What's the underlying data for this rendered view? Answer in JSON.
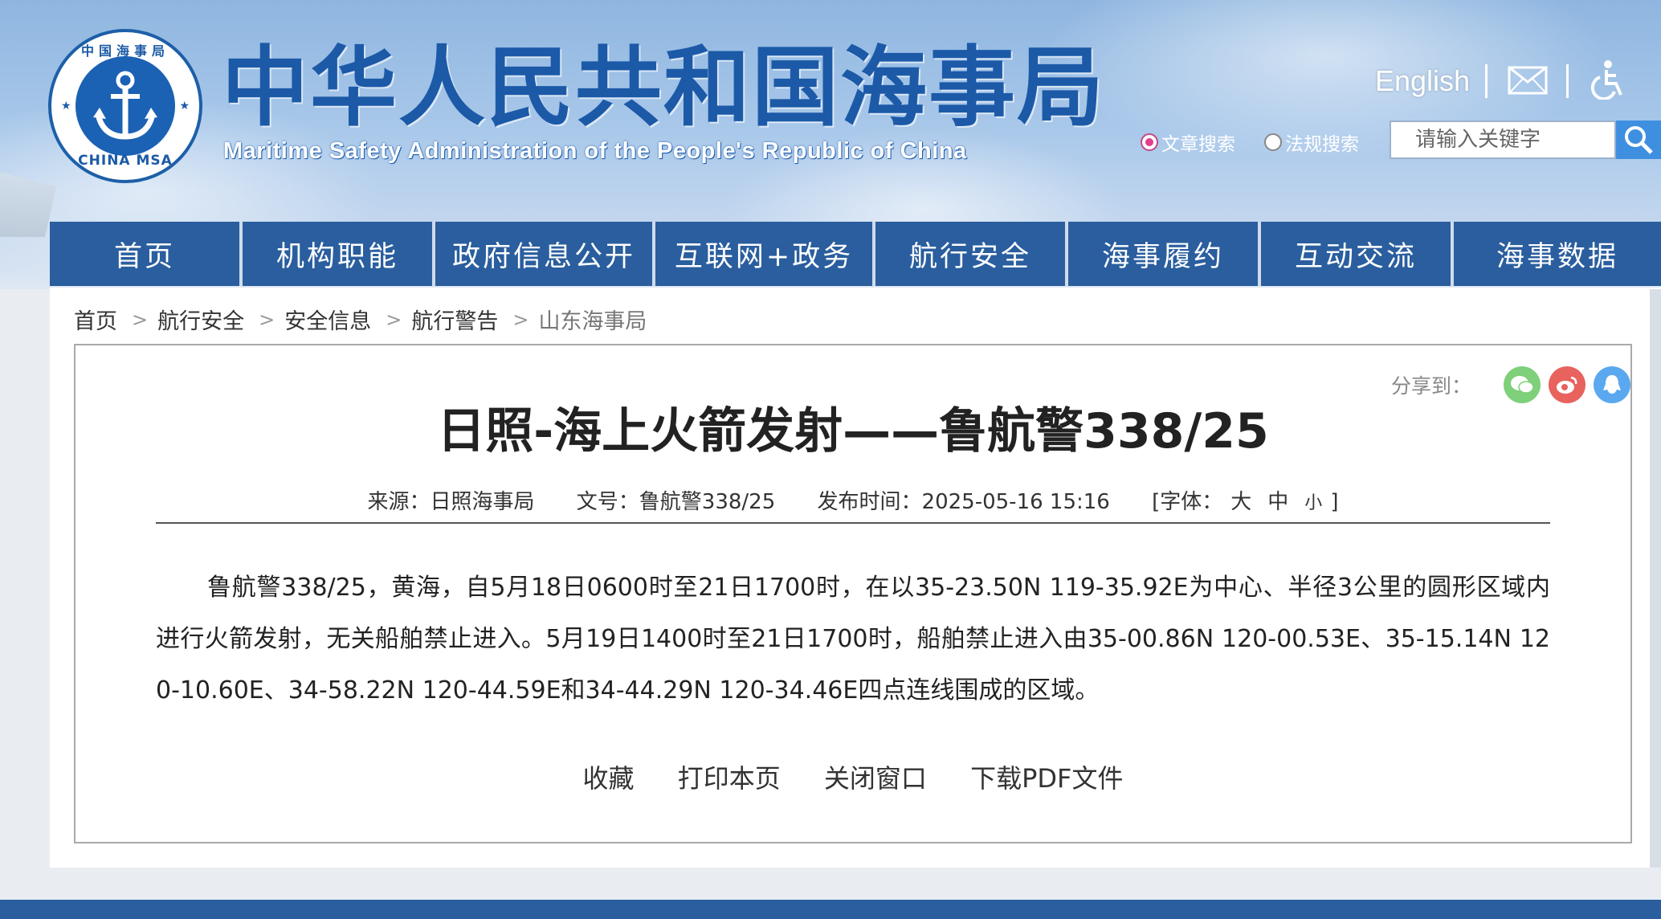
{
  "header": {
    "emblem_top_text": "中国海事局",
    "emblem_bottom_text": "CHINA MSA",
    "title": "中华人民共和国海事局",
    "subtitle": "Maritime Safety Administration of the People's Republic of China",
    "language_link": "English",
    "search": {
      "option_article": "文章搜索",
      "option_regulation": "法规搜索",
      "placeholder": "请输入关键字"
    }
  },
  "nav": {
    "items": [
      {
        "label": "首页"
      },
      {
        "label": "机构职能"
      },
      {
        "label": "政府信息公开"
      },
      {
        "label": "互联网+政务"
      },
      {
        "label": "航行安全"
      },
      {
        "label": "海事履约"
      },
      {
        "label": "互动交流"
      },
      {
        "label": "海事数据"
      }
    ]
  },
  "breadcrumb": {
    "items": [
      "首页",
      "航行安全",
      "安全信息",
      "航行警告",
      "山东海事局"
    ]
  },
  "share": {
    "label": "分享到："
  },
  "article": {
    "title": "日照-海上火箭发射——鲁航警338/25",
    "source": "来源：日照海事局",
    "doc_no": "文号：鲁航警338/25",
    "publish_time": "发布时间：2025-05-16 15:16",
    "font_label_open": "[字体：",
    "font_large": "大",
    "font_medium": "中",
    "font_small": "小",
    "font_label_close": "]",
    "body": "鲁航警338/25，黄海，自5月18日0600时至21日1700时，在以35-23.50N 119-35.92E为中心、半径3公里的圆形区域内进行火箭发射，无关船舶禁止进入。5月19日1400时至21日1700时，船舶禁止进入由35-00.86N 120-00.53E、35-15.14N 120-10.60E、34-58.22N 120-44.59E和34-44.29N 120-34.46E四点连线围成的区域。"
  },
  "actions": {
    "favorite": "收藏",
    "print": "打印本页",
    "close": "关闭窗口",
    "download_pdf": "下载PDF文件"
  },
  "colors": {
    "nav_bg": "#2a5e9e",
    "title_blue": "#1c5aa8",
    "wechat": "#7ed07a",
    "weibo": "#e8625e",
    "qq": "#5aa9f0"
  }
}
